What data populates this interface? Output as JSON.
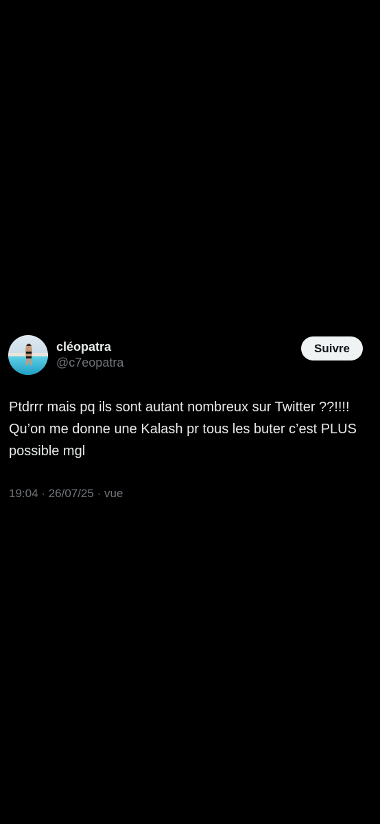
{
  "tweet": {
    "author": {
      "display_name": "cléopatra",
      "handle": "@c7eopatra"
    },
    "follow_label": "Suivre",
    "text": "Ptdrrr mais pq ils sont autant nombreux sur Twitter ??!!!! Qu’on me donne une Kalash pr tous les buter c’est PLUS possible mgl",
    "time": "19:04",
    "separator": "·",
    "date": "26/07/25",
    "views_label": "vue"
  },
  "colors": {
    "background": "#000000",
    "primary_text": "#e7e9ea",
    "secondary_text": "#71767b",
    "button_bg": "#eff3f4",
    "button_text": "#0f1419"
  }
}
